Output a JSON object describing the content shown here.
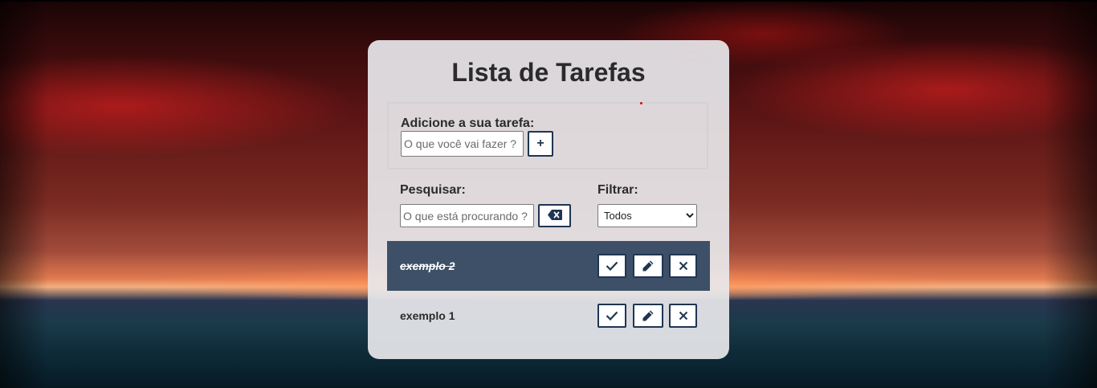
{
  "app": {
    "title": "Lista de Tarefas"
  },
  "add_form": {
    "label": "Adicione a sua tarefa:",
    "input_value": "",
    "input_placeholder": "O que você vai fazer ?",
    "button_label": "+"
  },
  "search": {
    "label": "Pesquisar:",
    "input_value": "",
    "input_placeholder": "O que está procurando ?",
    "clear_icon": "backspace-icon"
  },
  "filter": {
    "label": "Filtrar:",
    "selected": "Todos"
  },
  "todos": [
    {
      "text": "exemplo 2",
      "done": true
    },
    {
      "text": "exemplo 1",
      "done": false
    }
  ],
  "todo_actions": {
    "finish_icon": "check-icon",
    "edit_icon": "pencil-icon",
    "remove_icon": "close-icon"
  },
  "colors": {
    "accent": "#1f3553",
    "done_row_bg": "#3d5068",
    "card_bg": "#e8e8ec"
  }
}
